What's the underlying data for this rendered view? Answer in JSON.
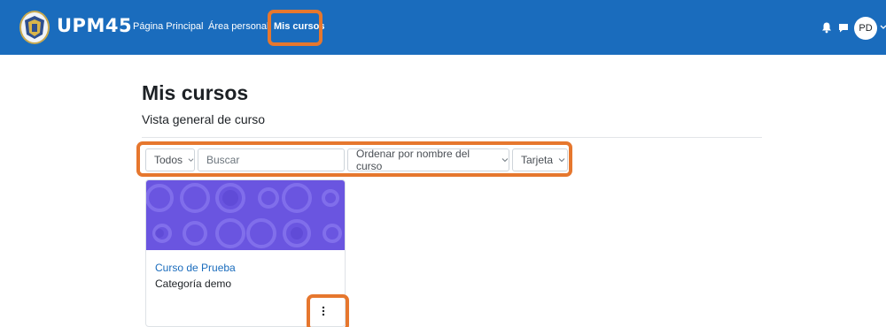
{
  "header": {
    "brand": "UPM45",
    "nav": [
      {
        "label": "Página Principal"
      },
      {
        "label": "Área personal"
      },
      {
        "label": "Mis cursos",
        "active": true
      }
    ],
    "icons": [
      "bell-icon",
      "chat-icon"
    ],
    "user_initials": "PD"
  },
  "page": {
    "title": "Mis cursos",
    "subtitle": "Vista general de curso"
  },
  "filters": {
    "grouping": "Todos",
    "search_placeholder": "Buscar",
    "sort": "Ordenar por nombre del curso",
    "view": "Tarjeta"
  },
  "courses": [
    {
      "name": "Curso de Prueba",
      "category": "Categoría demo"
    }
  ],
  "colors": {
    "navbar": "#1a6cbd",
    "highlight": "#e6772e",
    "course_image": "#6a55e0"
  }
}
